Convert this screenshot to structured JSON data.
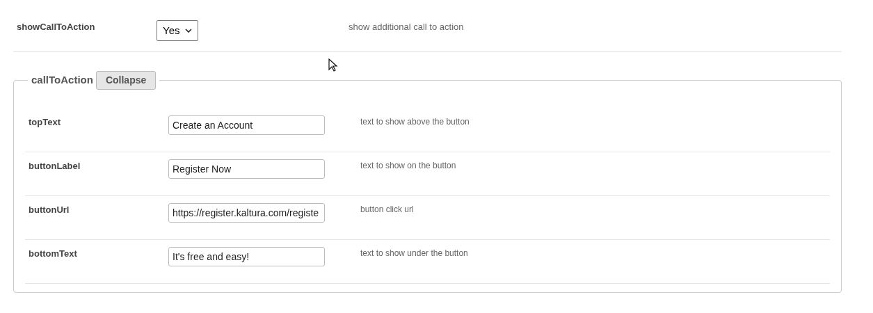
{
  "top_setting": {
    "label": "showCallToAction",
    "select_value": "Yes",
    "description": "show additional call to action"
  },
  "group": {
    "legend": "callToAction",
    "collapse_button": "Collapse",
    "fields": [
      {
        "label": "topText",
        "value": "Create an Account",
        "description": "text to show above the button"
      },
      {
        "label": "buttonLabel",
        "value": "Register Now",
        "description": "text to show on the button"
      },
      {
        "label": "buttonUrl",
        "value": "https://register.kaltura.com/registe",
        "description": "button click url"
      },
      {
        "label": "bottomText",
        "value": "It's free and easy!",
        "description": "text to show under the button"
      }
    ]
  }
}
